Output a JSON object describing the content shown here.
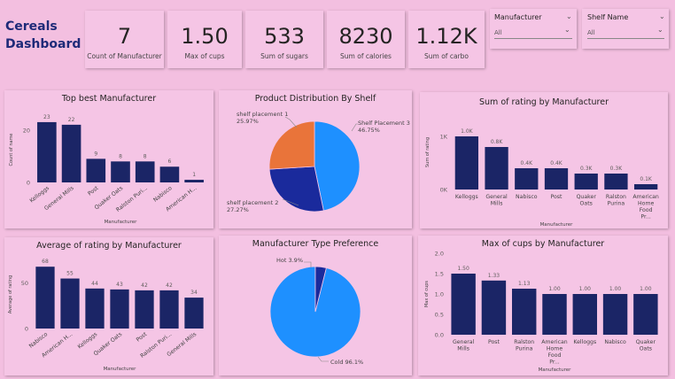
{
  "header": {
    "title_line1": "Cereals",
    "title_line2": "Dashboard"
  },
  "kpis": [
    {
      "value": "7",
      "label": "Count of Manufacturer"
    },
    {
      "value": "1.50",
      "label": "Max of cups"
    },
    {
      "value": "533",
      "label": "Sum of sugars"
    },
    {
      "value": "8230",
      "label": "Sum of calories"
    },
    {
      "value": "1.12K",
      "label": "Sum of carbo"
    }
  ],
  "slicers": [
    {
      "label": "Manufacturer",
      "value": "All"
    },
    {
      "label": "Shelf Name",
      "value": "All"
    }
  ],
  "colors": {
    "bar": "#1b2566",
    "pie_blue": "#1e90ff",
    "pie_navy": "#1a2a9c",
    "pie_orange": "#e9743a",
    "background": "#f3bfe0"
  },
  "chart_data": [
    {
      "id": "top_best",
      "type": "bar",
      "title": "Top best Manufacturer",
      "xlabel": "Manufacturer",
      "ylabel": "Count of name",
      "categories": [
        "Kelloggs",
        "General Mills",
        "Post",
        "Quaker Oats",
        "Ralston Puri...",
        "Nabisco",
        "American H..."
      ],
      "values": [
        23,
        22,
        9,
        8,
        8,
        6,
        1
      ],
      "data_labels": [
        "23",
        "22",
        "9",
        "8",
        "8",
        "6",
        "1"
      ],
      "yticks": [
        "0",
        "20"
      ],
      "ylim": [
        0,
        25
      ]
    },
    {
      "id": "shelf_pie",
      "type": "pie",
      "title": "Product Distribution By Shelf",
      "slices": [
        {
          "name": "Shelf Placement 3",
          "value": 46.75,
          "label": "Shelf Placement 3",
          "pct": "46.75%"
        },
        {
          "name": "shelf placement 2",
          "value": 27.27,
          "label": "shelf placement 2",
          "pct": "27.27%"
        },
        {
          "name": "shelf placement 1",
          "value": 25.97,
          "label": "shelf placement 1",
          "pct": "25.97%"
        }
      ]
    },
    {
      "id": "rating_sum",
      "type": "bar",
      "title": "Sum of rating by Manufacturer",
      "xlabel": "Manufacturer",
      "ylabel": "Sum of rating",
      "categories": [
        "Kelloggs",
        "General Mills",
        "Nabisco",
        "Post",
        "Quaker Oats",
        "Ralston Purina",
        "American Home Food Pr..."
      ],
      "values": [
        1.0,
        0.8,
        0.4,
        0.4,
        0.3,
        0.3,
        0.1
      ],
      "data_labels": [
        "1.0K",
        "0.8K",
        "0.4K",
        "0.4K",
        "0.3K",
        "0.3K",
        "0.1K"
      ],
      "yticks": [
        "0K",
        "1K"
      ],
      "ylim": [
        0,
        1.4
      ]
    },
    {
      "id": "rating_avg",
      "type": "bar",
      "title": "Average of rating by Manufacturer",
      "xlabel": "Manufacturer",
      "ylabel": "Average of rating",
      "categories": [
        "Nabisco",
        "American H...",
        "Kelloggs",
        "Quaker Oats",
        "Post",
        "Ralston Puri...",
        "General Mills"
      ],
      "values": [
        68,
        55,
        44,
        43,
        42,
        42,
        34
      ],
      "data_labels": [
        "68",
        "55",
        "44",
        "43",
        "42",
        "42",
        "34"
      ],
      "yticks": [
        "0",
        "50"
      ],
      "ylim": [
        0,
        75
      ]
    },
    {
      "id": "type_pie",
      "type": "pie",
      "title": "Manufacturer Type Preference",
      "slices": [
        {
          "name": "Cold",
          "value": 96.1,
          "label": "Cold 96.1%"
        },
        {
          "name": "Hot",
          "value": 3.9,
          "label": "Hot 3.9%"
        }
      ]
    },
    {
      "id": "cups_max",
      "type": "bar",
      "title": "Max of cups by Manufacturer",
      "xlabel": "Manufacturer",
      "ylabel": "Max of cups",
      "categories": [
        "General Mills",
        "Post",
        "Ralston Purina",
        "American Home Food Pr...",
        "Kelloggs",
        "Nabisco",
        "Quaker Oats"
      ],
      "values": [
        1.5,
        1.33,
        1.13,
        1.0,
        1.0,
        1.0,
        1.0
      ],
      "data_labels": [
        "1.50",
        "1.33",
        "1.13",
        "1.00",
        "1.00",
        "1.00",
        "1.00"
      ],
      "yticks": [
        "0.0",
        "0.5",
        "1.0",
        "1.5",
        "2.0"
      ],
      "ylim": [
        0,
        2.0
      ]
    }
  ]
}
